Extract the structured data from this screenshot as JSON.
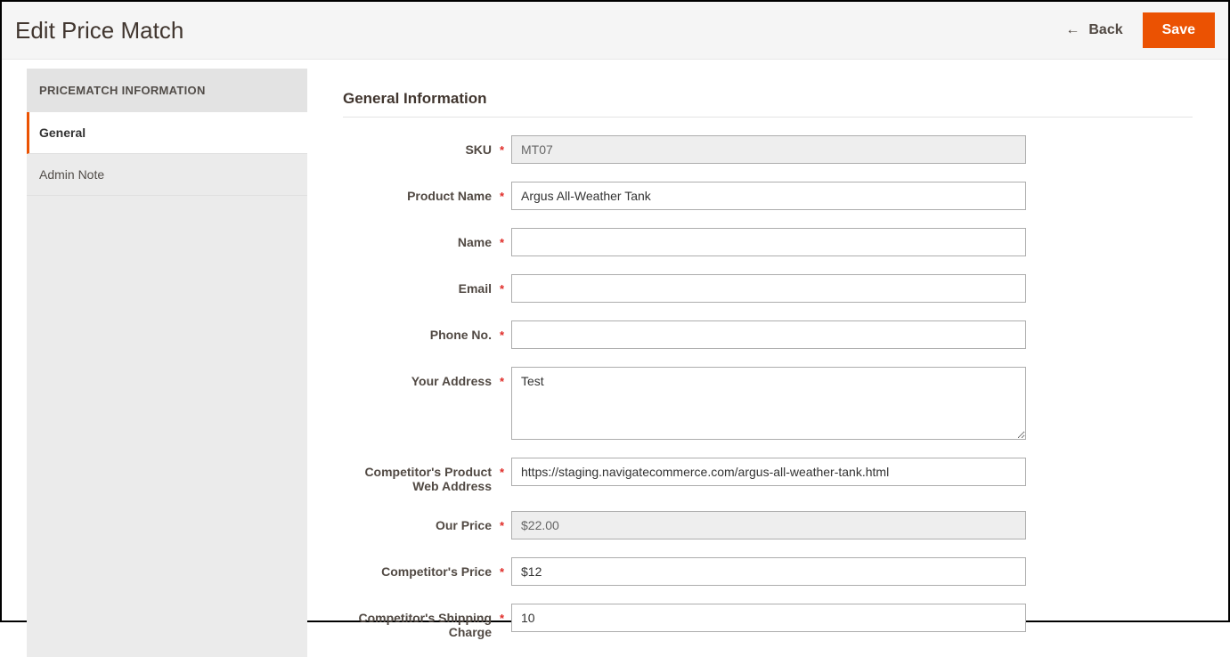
{
  "header": {
    "title": "Edit Price Match",
    "back_label": "Back",
    "save_label": "Save"
  },
  "sidebar": {
    "title": "PRICEMATCH INFORMATION",
    "items": [
      {
        "label": "General",
        "active": true
      },
      {
        "label": "Admin Note",
        "active": false
      }
    ]
  },
  "section": {
    "title": "General Information"
  },
  "form": {
    "sku": {
      "label": "SKU",
      "value": "MT07",
      "required": true,
      "disabled": true
    },
    "product_name": {
      "label": "Product Name",
      "value": "Argus All-Weather Tank",
      "required": true,
      "disabled": false
    },
    "name": {
      "label": "Name",
      "value": "",
      "required": true,
      "disabled": false
    },
    "email": {
      "label": "Email",
      "value": "",
      "required": true,
      "disabled": false
    },
    "phone": {
      "label": "Phone No.",
      "value": "",
      "required": true,
      "disabled": false
    },
    "address": {
      "label": "Your Address",
      "value": "Test",
      "required": true,
      "disabled": false
    },
    "competitor_url": {
      "label": "Competitor's Product Web Address",
      "value": "https://staging.navigatecommerce.com/argus-all-weather-tank.html",
      "required": true,
      "disabled": false
    },
    "our_price": {
      "label": "Our Price",
      "value": "$22.00",
      "required": true,
      "disabled": true
    },
    "competitor_price": {
      "label": "Competitor's Price",
      "value": "$12",
      "required": true,
      "disabled": false
    },
    "competitor_shipping": {
      "label": "Competitor's Shipping Charge",
      "value": "10",
      "required": true,
      "disabled": false
    }
  }
}
